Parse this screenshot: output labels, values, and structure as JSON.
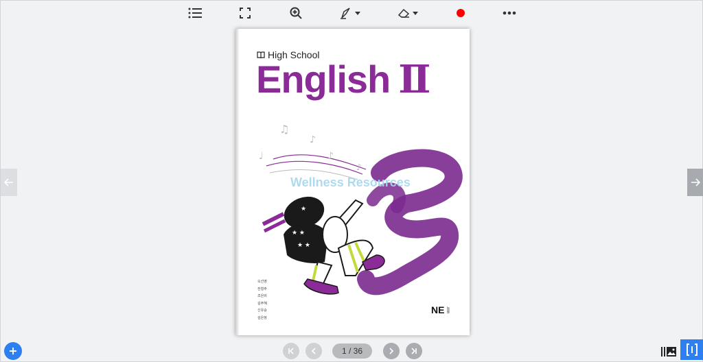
{
  "toolbar": {
    "icons": [
      "list-icon",
      "fullscreen-icon",
      "zoom-in-icon",
      "pen-icon",
      "eraser-icon",
      "record-icon",
      "more-icon"
    ],
    "record_color": "#ff0000"
  },
  "book": {
    "series_label": "High School",
    "title": "English",
    "title_numeral": "Ⅱ",
    "watermark": "Wellness Resources",
    "authors": [
      "오선영",
      "전형주",
      "조은비",
      "김주혜",
      "신유승",
      "김은정"
    ],
    "publisher": "NE",
    "publisher_sub": "능률",
    "title_color": "#8a2b97",
    "accent_color": "#7b2a8f"
  },
  "pagination": {
    "indicator": "1 / 36",
    "current_page": 1,
    "total_pages": 36
  },
  "colors": {
    "primary": "#2e7ff0",
    "background": "#f1f2f4"
  }
}
